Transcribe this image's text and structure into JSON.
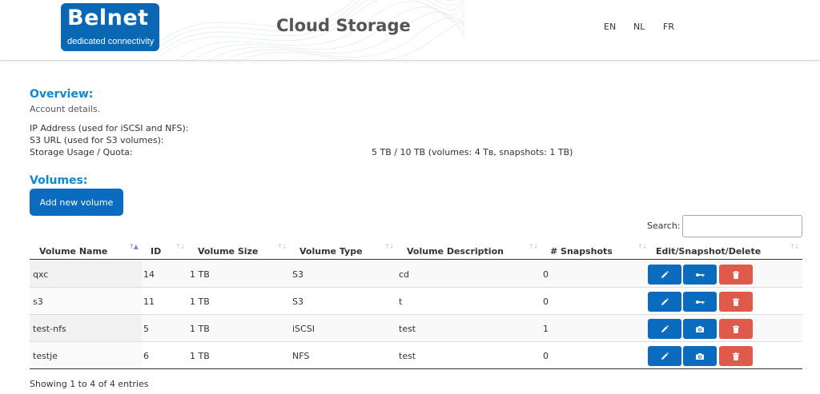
{
  "header": {
    "logo_main": "Belnet",
    "logo_sub": "dedicated connectivity",
    "title": "Cloud Storage",
    "languages": [
      "EN",
      "NL",
      "FR"
    ]
  },
  "overview": {
    "heading": "Overview:",
    "subheading": "Account details.",
    "ip_label": "IP Address (used for iSCSI and NFS):",
    "s3_label": "S3 URL (used for S3 volumes):",
    "usage_label": "Storage Usage / Quota:",
    "usage_value": "5 TB / 10 TB (volumes: 4 Tʙ, snapshots: 1 TB)"
  },
  "volumes": {
    "heading": "Volumes:",
    "add_button": "Add new volume",
    "search_label": "Search:",
    "search_value": "",
    "columns": [
      "Volume Name",
      "ID",
      "Volume Size",
      "Volume Type",
      "Volume Description",
      "# Snapshots",
      "Edit/Snapshot/Delete"
    ],
    "rows": [
      {
        "name": "qxc",
        "id": "14",
        "size": "1 TB",
        "type": "S3",
        "description": "cd",
        "snapshots": "0",
        "middle_action_icon": "key-icon"
      },
      {
        "name": "s3",
        "id": "11",
        "size": "1 TB",
        "type": "S3",
        "description": "t",
        "snapshots": "0",
        "middle_action_icon": "key-icon"
      },
      {
        "name": "test-nfs",
        "id": "5",
        "size": "1 TB",
        "type": "iSCSI",
        "description": "test",
        "snapshots": "1",
        "middle_action_icon": "camera-icon"
      },
      {
        "name": "testje",
        "id": "6",
        "size": "1 TB",
        "type": "NFS",
        "description": "test",
        "snapshots": "0",
        "middle_action_icon": "camera-icon"
      }
    ],
    "footer": "Showing 1 to 4 of 4 entries"
  },
  "colors": {
    "brand_blue": "#0a67b4",
    "heading_blue": "#0a8bd1",
    "button_blue": "#0b6bbf",
    "delete_red": "#de5a4b"
  }
}
